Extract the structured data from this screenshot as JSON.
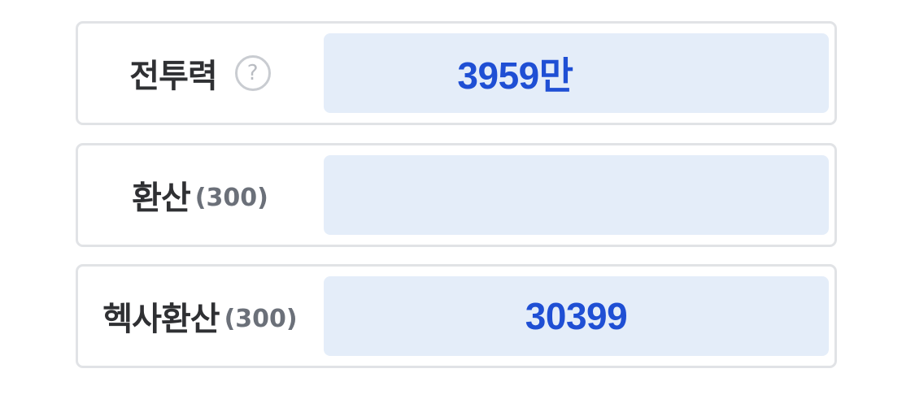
{
  "rows": [
    {
      "label": "전투력",
      "sub": "",
      "value": "3959만",
      "help_icon": "question-mark-circle-icon",
      "help_glyph": "?"
    },
    {
      "label": "환산",
      "sub": "(300)",
      "value": ""
    },
    {
      "label": "헥사환산",
      "sub": "(300)",
      "value": "30399"
    }
  ],
  "colors": {
    "value_text": "#1f4fd4",
    "value_bg": "#e4edf9",
    "label_text": "#2f3033",
    "sub_text": "#6b7079",
    "border": "#e1e3e6"
  }
}
